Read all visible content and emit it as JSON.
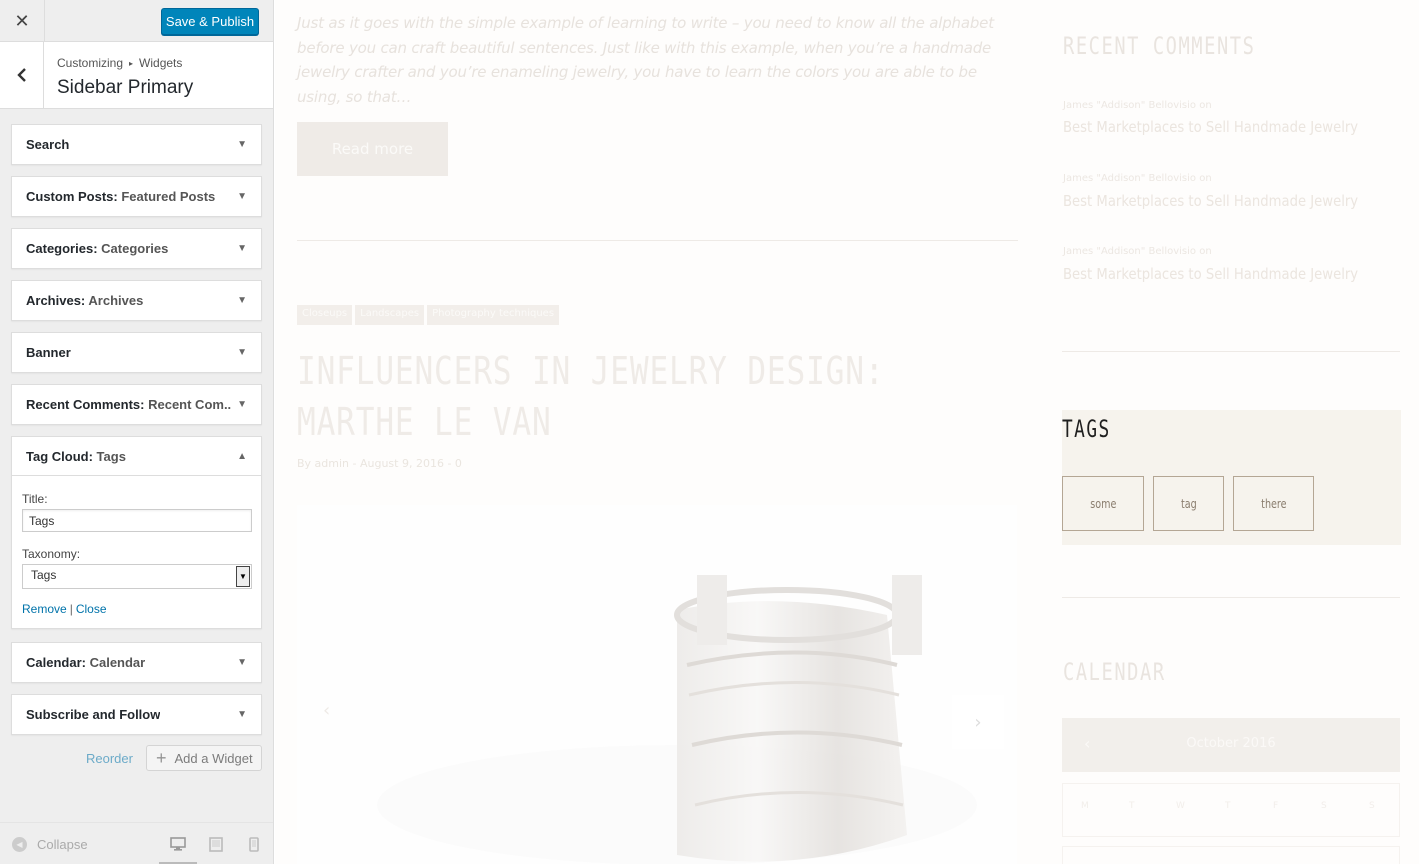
{
  "topbar": {
    "close_icon": "close-icon",
    "publish_label": "Save & Publish"
  },
  "section": {
    "breadcrumb_parent": "Customizing",
    "breadcrumb_current": "Widgets",
    "title": "Sidebar Primary"
  },
  "widgets": [
    {
      "name": "Search",
      "title": ""
    },
    {
      "name": "Custom Posts:",
      "title": "Featured Posts"
    },
    {
      "name": "Categories:",
      "title": "Categories"
    },
    {
      "name": "Archives:",
      "title": "Archives"
    },
    {
      "name": "Banner",
      "title": ""
    },
    {
      "name": "Recent Comments:",
      "title": "Recent Com..."
    },
    {
      "name": "Tag Cloud:",
      "title": "Tags"
    },
    {
      "name": "Calendar:",
      "title": "Calendar"
    },
    {
      "name": "Subscribe and Follow",
      "title": ""
    }
  ],
  "tag_cloud_form": {
    "title_label": "Title:",
    "title_value": "Tags",
    "taxonomy_label": "Taxonomy:",
    "taxonomy_value": "Tags",
    "remove_label": "Remove",
    "separator": "|",
    "close_label": "Close"
  },
  "panel_actions": {
    "reorder_label": "Reorder",
    "add_widget_label": "Add a Widget"
  },
  "footer": {
    "collapse_label": "Collapse",
    "active_device": "desktop"
  },
  "preview": {
    "excerpt": "Just as it goes with the simple example of learning to write – you need to know all the alphabet before you can craft beautiful sentences. Just like with this example, when you’re a handmade jewelry crafter and you’re enameling jewelry, you have to learn the colors you are able to be using, so that…",
    "read_more": "Read more",
    "categories": [
      "Closeups",
      "Landscapes",
      "Photography techniques"
    ],
    "post_title": "INFLUENCERS IN JEWELRY DESIGN: MARTHE LE VAN",
    "post_meta": "By admin - August 9, 2016 - 0",
    "recent_comments_heading": "RECENT COMMENTS",
    "recent_comments": [
      {
        "author": "James \"Addison\" Bellovisio on",
        "post": "Best Marketplaces to Sell Handmade Jewelry"
      },
      {
        "author": "James \"Addison\" Bellovisio on",
        "post": "Best Marketplaces to Sell Handmade Jewelry"
      },
      {
        "author": "James \"Addison\" Bellovisio on",
        "post": "Best Marketplaces to Sell Handmade Jewelry"
      }
    ],
    "tags_heading": "TAGS",
    "tags": [
      "some",
      "tag",
      "there"
    ],
    "calendar_heading": "CALENDAR",
    "calendar_month": "October 2016",
    "calendar_days": [
      "M",
      "T",
      "W",
      "T",
      "F",
      "S",
      "S"
    ]
  },
  "colors": {
    "primary": "#0085ba",
    "link": "#0073aa",
    "panel_bg": "#eeeeee",
    "tags_bg": "#f6f3ed",
    "tag_border": "#b4a694"
  }
}
